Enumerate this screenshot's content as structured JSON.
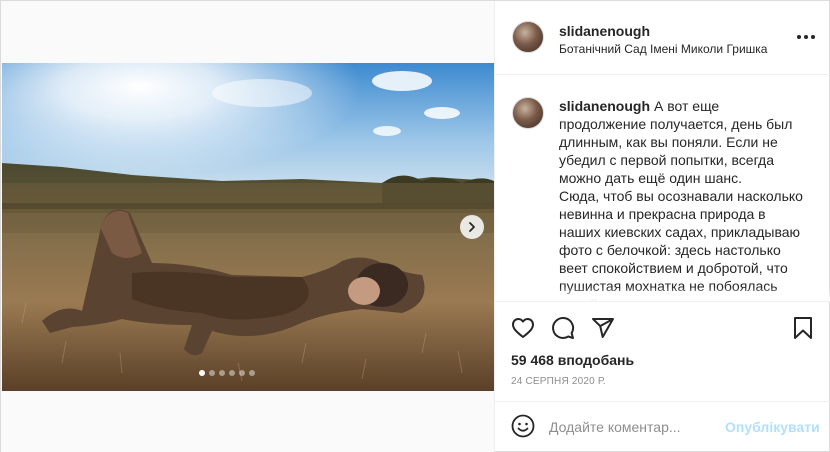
{
  "post": {
    "username": "slidanenough",
    "location": "Ботанічний Сад Імені Миколи Гришка",
    "caption_lines": [
      "А вот еще продолжение получается, день был длинным, как вы поняли. Если не убедил с первой попытки, всегда можно дать ещё один шанс.",
      "Сюда, чтоб вы осознавали насколько невинна и прекрасна природа в наших киевских садах, прикладываю фото с белочкой: здесь настолько веет спокойствием и добротой, что пушистая мохнатка не побоялась подойти и позировать"
    ],
    "likes": "59 468 вподобань",
    "date": "24 СЕРПНЯ 2020 Р."
  },
  "icons": {
    "more": "more-horizontal-icon",
    "like": "heart-icon",
    "comment": "comment-icon",
    "share": "send-icon",
    "save": "bookmark-icon",
    "emoji": "emoji-icon",
    "next": "chevron-right-icon"
  },
  "compose": {
    "placeholder": "Додайте коментар...",
    "publish_label": "Опублікувати"
  },
  "carousel": {
    "slide_count": 6,
    "active_index": 0
  },
  "colors": {
    "accent_disabled": "#b2dffc",
    "text": "#262626",
    "muted": "#8e8e8e",
    "border": "#efefef"
  }
}
